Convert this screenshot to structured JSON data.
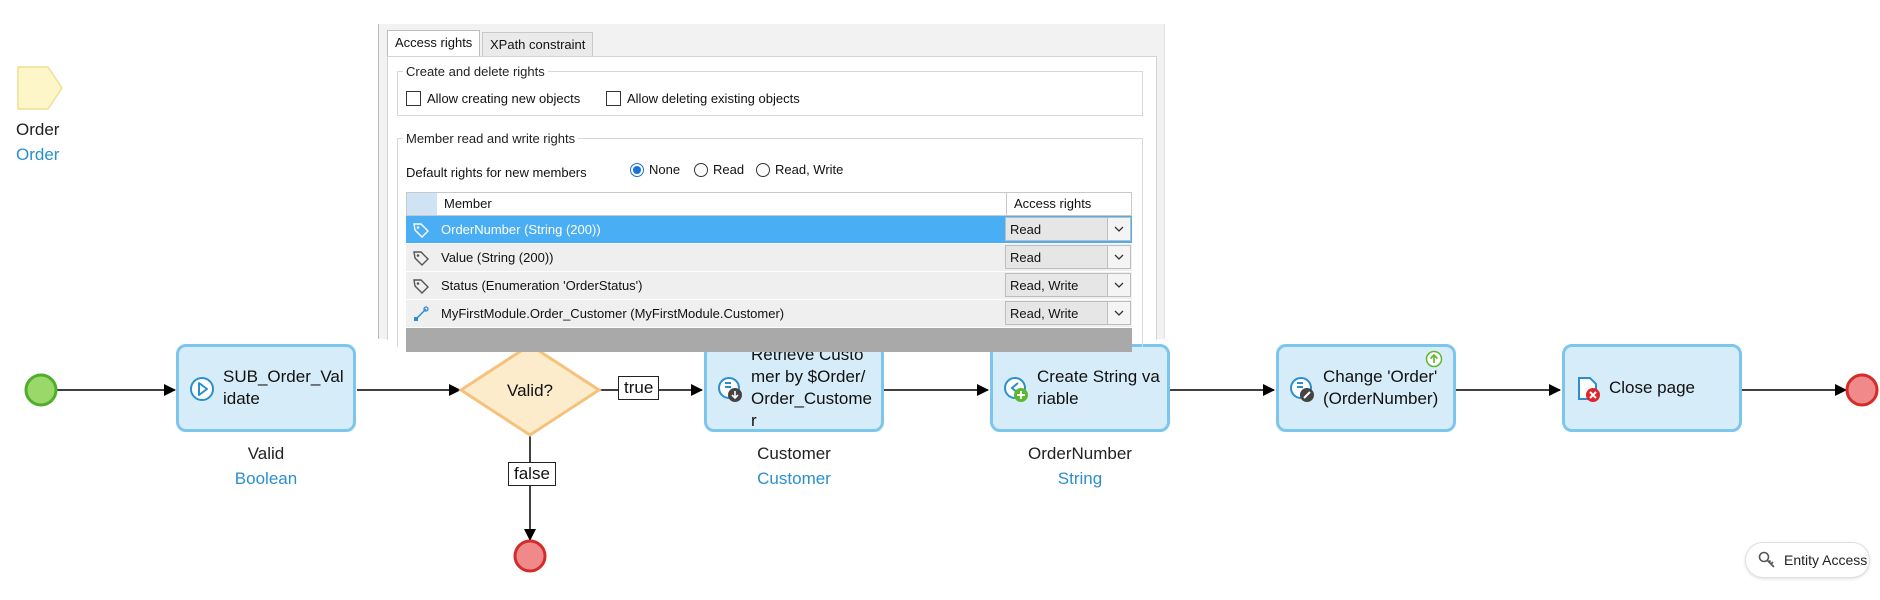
{
  "parameter": {
    "name": "Order",
    "type": "Order"
  },
  "popup": {
    "tabs": [
      "Access rights",
      "XPath constraint"
    ],
    "create_delete": {
      "legend": "Create and delete rights",
      "allow_create": "Allow creating new objects",
      "allow_delete": "Allow deleting existing objects"
    },
    "member_rights": {
      "legend": "Member read and write rights",
      "default_label": "Default rights for new members",
      "options": [
        "None",
        "Read",
        "Read, Write"
      ],
      "selected": "None"
    },
    "grid": {
      "columns": [
        "Member",
        "Access rights"
      ],
      "rows": [
        {
          "icon": "tag-icon",
          "member": "OrderNumber (String (200))",
          "access": "Read",
          "selected": true
        },
        {
          "icon": "tag-icon",
          "member": "Value (String (200))",
          "access": "Read",
          "selected": false
        },
        {
          "icon": "tag-icon",
          "member": "Status (Enumeration 'OrderStatus')",
          "access": "Read, Write",
          "selected": false
        },
        {
          "icon": "association-icon",
          "member": "MyFirstModule.Order_Customer (MyFirstModule.Customer)",
          "access": "Read, Write",
          "selected": false
        }
      ]
    }
  },
  "flow": {
    "activities": [
      {
        "id": "sub",
        "text": "SUB_Order_Validate",
        "icon": "submicroflow-icon",
        "output_name": "Valid",
        "output_type": "Boolean"
      },
      {
        "id": "retrieve",
        "text": "Retrieve Customer by $Order/Order_Customer",
        "icon": "retrieve-icon",
        "output_name": "Customer",
        "output_type": "Customer"
      },
      {
        "id": "create",
        "text": "Create String variable",
        "icon": "create-variable-icon",
        "output_name": "OrderNumber",
        "output_type": "String"
      },
      {
        "id": "change",
        "text": "Change 'Order' (OrderNumber)",
        "icon": "change-object-icon",
        "output_name": "",
        "output_type": ""
      },
      {
        "id": "close",
        "text": "Close page",
        "icon": "close-page-icon",
        "output_name": "",
        "output_type": ""
      }
    ],
    "decision": {
      "text": "Valid?",
      "true_label": "true",
      "false_label": "false"
    }
  },
  "entity_access_button": {
    "label": "Entity Access",
    "icon": "key-icon"
  },
  "colors": {
    "start": "#9bd86a",
    "end": "#f08a8a",
    "activity_fill": "#d6ecf8",
    "activity_border": "#7cc6ee",
    "decision_fill": "#fdeccb",
    "decision_border": "#f5c27c",
    "selection": "#4aaef4",
    "link": "#2a8fcf"
  }
}
